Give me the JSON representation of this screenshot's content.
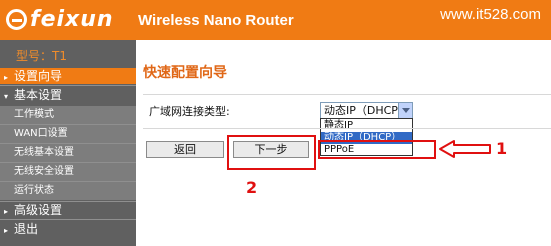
{
  "header": {
    "logo": "feixun",
    "title": "Wireless Nano Router",
    "watermark": "www.it528.com"
  },
  "sidebar": {
    "model": "型号：T1",
    "items": [
      {
        "label": "设置向导",
        "active": true
      },
      {
        "label": "基本设置",
        "expanded": true
      },
      {
        "label": "工作模式"
      },
      {
        "label": "WAN口设置"
      },
      {
        "label": "无线基本设置"
      },
      {
        "label": "无线安全设置"
      },
      {
        "label": "运行状态"
      },
      {
        "label": "高级设置"
      },
      {
        "label": "退出"
      }
    ]
  },
  "main": {
    "title": "快速配置向导",
    "connection_type_label": "广域网连接类型:",
    "select_value": "动态IP（DHCP）",
    "options": [
      "静态IP",
      "动态IP（DHCP）",
      "PPPoE"
    ],
    "selected_option_index": 1,
    "back_label": "返回",
    "next_label": "下一步"
  },
  "annotations": {
    "number_1": "1",
    "number_2": "2",
    "color": "#e01010"
  },
  "colors": {
    "accent": "#f07b14",
    "sidebar": "#606060"
  }
}
